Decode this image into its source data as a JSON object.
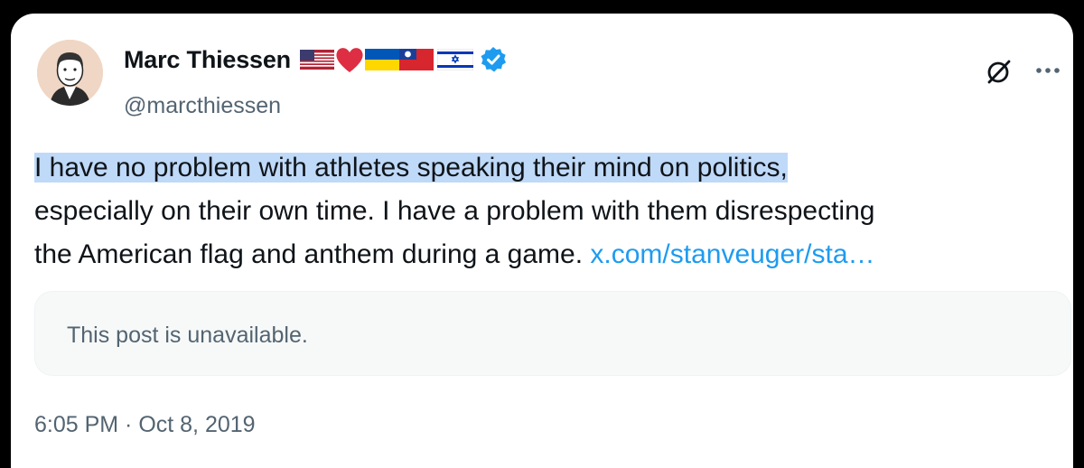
{
  "author": {
    "display_name": "Marc Thiessen",
    "handle": "@marcthiessen",
    "verified": true,
    "name_emojis": [
      "us-flag",
      "red-heart",
      "ukraine-flag",
      "taiwan-flag",
      "israel-flag"
    ]
  },
  "header_actions": {
    "grok_icon": "grok-icon",
    "more_icon": "more-icon"
  },
  "tweet": {
    "highlighted_line": "I have no problem with athletes speaking their mind on politics,",
    "line_2": "especially on their own time. I have a problem with them disrespecting",
    "line_3": "the American flag and anthem during a game. ",
    "link_text": "x.com/stanveuger/sta…"
  },
  "quote": {
    "unavailable_text": "This post is unavailable."
  },
  "timestamp": "6:05 PM · Oct 8, 2019",
  "colors": {
    "link": "#1d9bf0",
    "highlight": "#bfd9f8",
    "verified_badge": "#1d9bf0"
  }
}
